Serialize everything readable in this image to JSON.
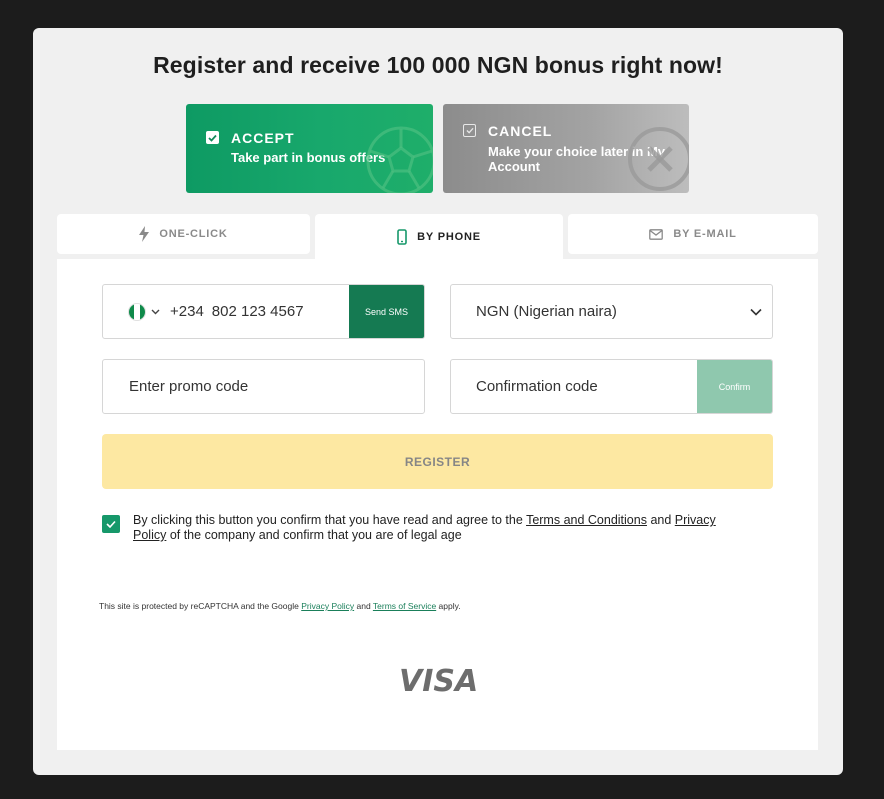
{
  "header": {
    "title": "Register and receive 100 000 NGN bonus right now!"
  },
  "bonus": {
    "accept": {
      "title": "ACCEPT",
      "subtitle": "Take part in bonus offers"
    },
    "cancel": {
      "title": "CANCEL",
      "subtitle": "Make your choice later in My Account"
    }
  },
  "tabs": [
    {
      "label": "ONE-CLICK",
      "icon": "lightning-icon"
    },
    {
      "label": "BY PHONE",
      "icon": "phone-icon",
      "active": true
    },
    {
      "label": "BY E-MAIL",
      "icon": "envelope-icon"
    }
  ],
  "form": {
    "phone_code": "+234",
    "phone_value": "802 123 4567",
    "send_sms_label": "Send SMS",
    "currency_value": "NGN (Nigerian naira)",
    "promo_placeholder": "Enter promo code",
    "confirmation_placeholder": "Confirmation code",
    "confirm_label": "Confirm",
    "register_label": "REGISTER"
  },
  "agreement": {
    "text_1": "By clicking this button you confirm that you have read and agree to the ",
    "terms_link": "Terms and Conditions",
    "text_2": " and ",
    "privacy_link": "Privacy Policy",
    "text_3": " of the company and confirm that you are of legal age"
  },
  "recaptcha": {
    "text_1": "This site is protected by reCAPTCHA and the Google ",
    "privacy_link": "Privacy Policy",
    "text_2": " and ",
    "terms_link": "Terms of Service",
    "text_3": " apply."
  },
  "footer": {
    "payment_logo": "VISA"
  },
  "colors": {
    "accent_green": "#157a52",
    "register_yellow": "#fde8a2",
    "flag_green": "#0f8a4a"
  }
}
